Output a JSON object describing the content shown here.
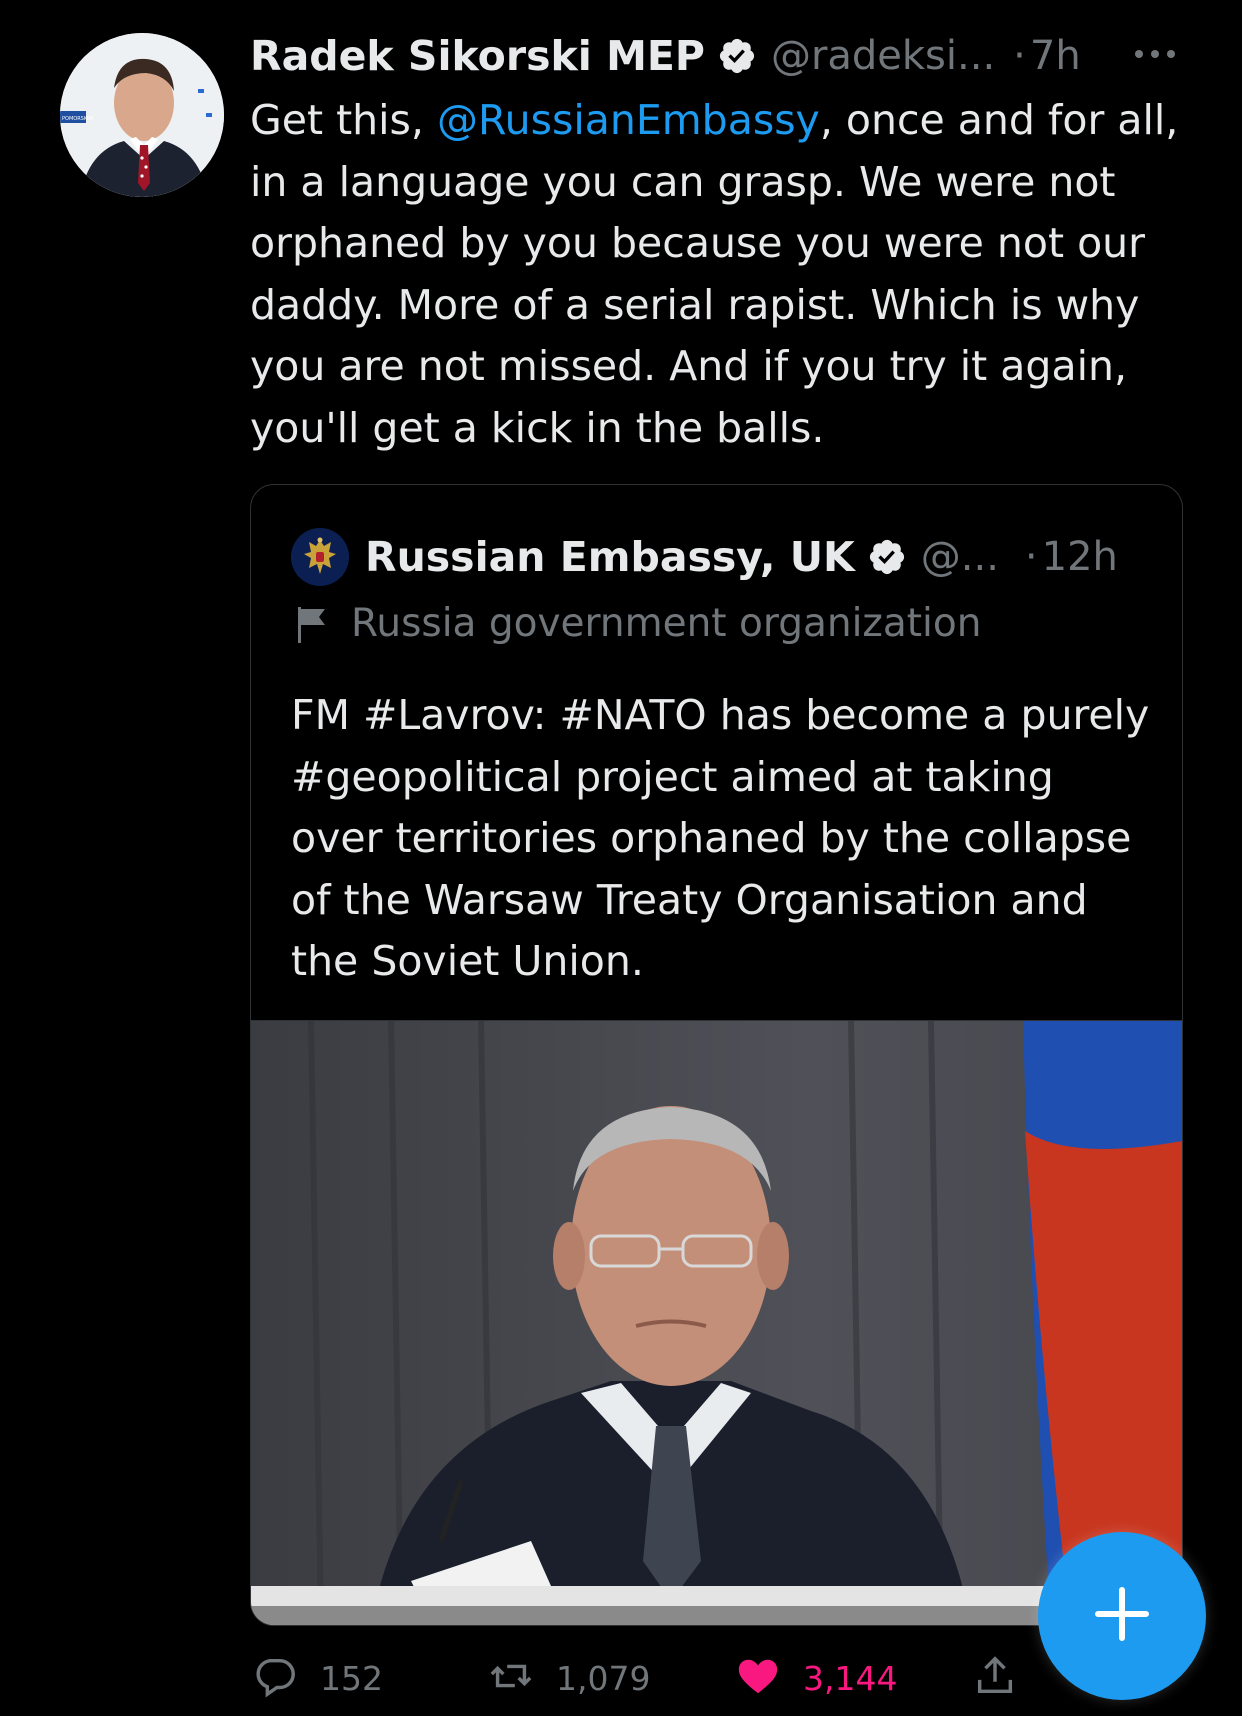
{
  "tweet": {
    "author_name": "Radek Sikorski MEP",
    "handle": "@radeksi...",
    "separator": "·",
    "time": "7h",
    "text_before_mention": "Get this, ",
    "mention": "@RussianEmbassy",
    "text_after_mention": ", once and for all, in a language you can grasp. We were not orphaned by you because you were not our daddy. More of a serial rapist. Which is why you are not missed. And if you try it again, you'll get a kick in the balls.",
    "avatar_badge_text": "POMORSKIM"
  },
  "quoted_tweet": {
    "author_name": "Russian Embassy, UK",
    "handle": "@...",
    "separator": "·",
    "time": "12h",
    "label": "Russia government organization",
    "text": "FM #Lavrov: #NATO has become a purely #geopolitical project aimed at taking over territories orphaned by the collapse of the Warsaw Treaty Organisation and the Soviet Union."
  },
  "actions": {
    "replies": "152",
    "retweets": "1,079",
    "likes": "3,144"
  },
  "colors": {
    "background": "#000000",
    "text": "#e7e9ea",
    "muted": "#71767b",
    "accent": "#1d9bf0",
    "like": "#f91880",
    "border": "#2f3336"
  },
  "icons": [
    "verified-badge-icon",
    "more-options-icon",
    "government-flag-icon",
    "reply-icon",
    "retweet-icon",
    "like-icon",
    "share-icon",
    "plus-icon"
  ]
}
